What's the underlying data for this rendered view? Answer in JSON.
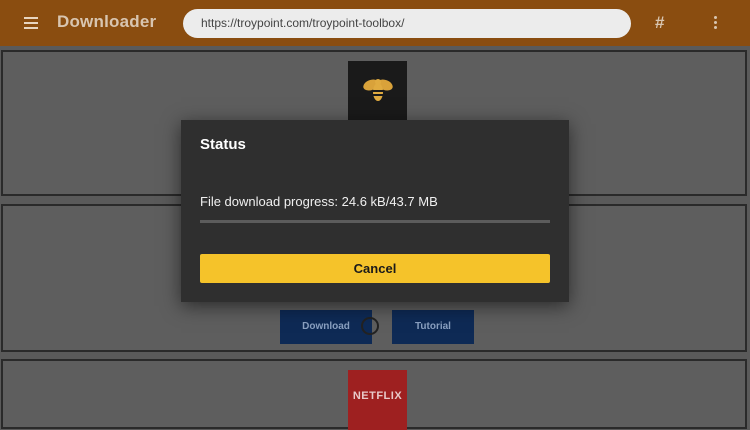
{
  "app": {
    "title": "Downloader",
    "menu_icon": "hamburger-menu-icon",
    "hash_icon": "#",
    "more_icon": "more-vertical-icon"
  },
  "address_bar": {
    "url": "https://troypoint.com/troypoint-toolbox/"
  },
  "page": {
    "cards": [
      {
        "thumbnail": "bee-logo"
      },
      {
        "buttons": {
          "download_label": "Download",
          "tutorial_label": "Tutorial"
        }
      },
      {
        "thumbnail_text": "NETFLIX"
      }
    ]
  },
  "dialog": {
    "title": "Status",
    "progress_text": "File download progress: 24.6 kB/43.7 MB",
    "progress_fraction": 0.0,
    "cancel_label": "Cancel"
  },
  "colors": {
    "topbar": "#8a4d10",
    "accent": "#f5c32a",
    "dialog_bg": "#2f2f2f"
  }
}
